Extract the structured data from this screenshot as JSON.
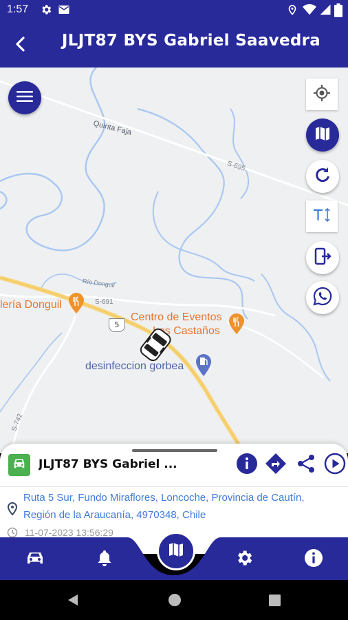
{
  "status_bar": {
    "time": "1:57",
    "icons": [
      "settings-icon",
      "mail-icon",
      "location-icon",
      "wifi-icon",
      "signal-icon",
      "battery-icon"
    ]
  },
  "app_bar": {
    "title": "JLJT87 BYS Gabriel Saavedra",
    "back_icon": "arrow-left-icon",
    "color": "#282a9a"
  },
  "map": {
    "labels": {
      "quinta_faja": "Quinta Faja",
      "road_s695": "S-695",
      "road_s691": "S-691",
      "rio_donguil": "Río Donguil",
      "route_5": "5",
      "road_s742": "S-742",
      "poi_donguil": "lería Donguil",
      "poi_centro_line1": "Centro de Eventos",
      "poi_centro_line2": "Los Castaños",
      "poi_desinfeccion": "desinfeccion gorbea"
    },
    "controls": [
      "menu-icon",
      "my-location-icon",
      "map-icon",
      "refresh-icon",
      "text-size-icon",
      "exit-icon",
      "whatsapp-icon"
    ]
  },
  "vehicle_sheet": {
    "name": "JLJT87 BYS Gabriel ...",
    "address": "Ruta 5 Sur, Fundo Miraflores, Loncoche, Provincia de Cautín, Región de la Araucanía, 4970348, Chile",
    "datetime": "11-07-2023 13:56:29",
    "actions": [
      "info-icon",
      "directions-icon",
      "share-icon",
      "play-icon"
    ],
    "status_color": "#4caf50",
    "address_color": "#3f7bd8"
  },
  "bottom_nav": {
    "items": [
      "car-icon",
      "bell-icon",
      "map-icon",
      "gear-icon",
      "info-icon"
    ],
    "active": "map-icon"
  }
}
